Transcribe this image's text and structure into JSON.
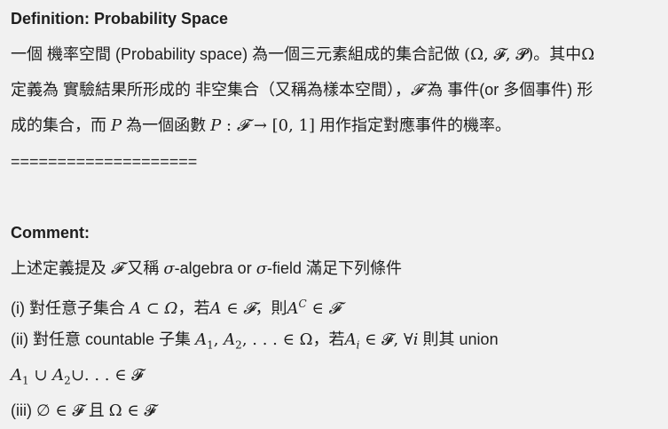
{
  "definition": {
    "title": "Definition: Probability Space",
    "line1": {
      "text": "一個 機率空間 (Probability space) 為一個三元素組成的集合記做",
      "math": "(Ω, 𝓕, 𝓟)",
      "tail": "。其中",
      "omega": "Ω"
    },
    "line2": {
      "text": "定義為 實驗結果所形成的 非空集合（又稱為樣本空間），",
      "f": "𝓕",
      "text2": " 為 事件(or 多個事件) 形"
    },
    "line3": {
      "text": "成的集合，而",
      "p": "P",
      "text2": "為一個函數",
      "func": "P",
      "colon": " : ",
      "f": "𝓕",
      "arrow": " → ",
      "interval": "[0, 1]",
      "text3": "用作指定對應事件的機率。"
    },
    "separator": "===================="
  },
  "comment": {
    "title": "Comment:",
    "intro": {
      "text": "上述定義提及",
      "f": "𝓕",
      "text2": "又稱",
      "sigma1": "σ",
      "text3": "-algebra or",
      "sigma2": "σ",
      "text4": "-field 滿足下列條件"
    },
    "item1": {
      "label": "(i) 對任意子集合",
      "math1": "A ⊂ Ω",
      "text1": "，若",
      "math2": "A ∈ 𝓕",
      "text2": "，則",
      "math3": "A",
      "sup": "C",
      "math4": " ∈ 𝓕"
    },
    "item2": {
      "label": "(ii) 對任意 countable 子集",
      "a1": "A",
      "s1": "1",
      "comma1": ", ",
      "a2": "A",
      "s2": "2",
      "rest": ", . . . ∈ Ω",
      "text1": "，若",
      "ai": "A",
      "si": "i",
      "rest2": " ∈ 𝓕,   ∀",
      "i": "i",
      "text2": " 則其 union"
    },
    "item2b": {
      "a1": "A",
      "s1": "1",
      "cup1": " ∪ ",
      "a2": "A",
      "s2": "2",
      "rest": "∪. . . ∈ 𝓕"
    },
    "item3": {
      "label": "(iii)",
      "math1": "∅ ∈ 𝓕",
      "text": " 且 ",
      "math2": "Ω ∈ 𝓕"
    }
  }
}
